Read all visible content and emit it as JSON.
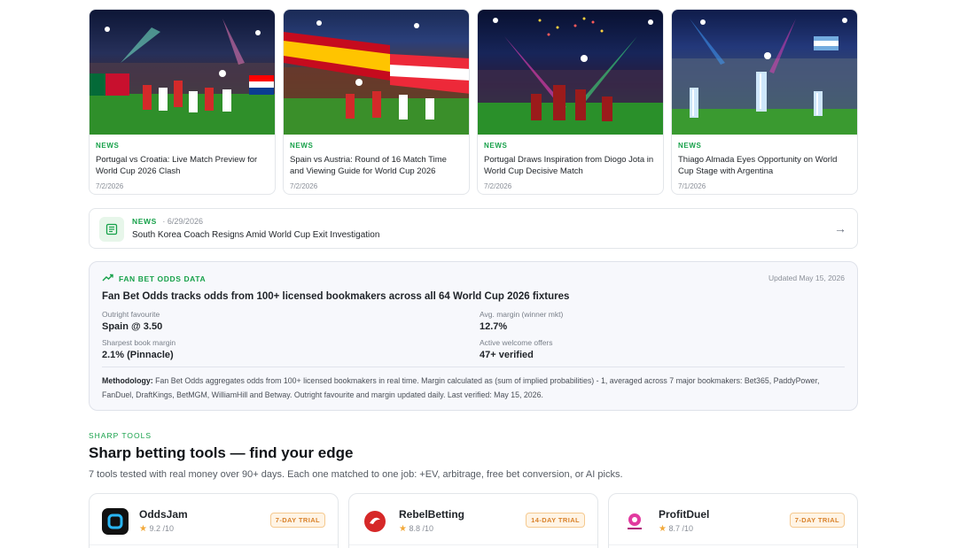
{
  "news_cards": [
    {
      "tag": "NEWS",
      "title": "Portugal vs Croatia: Live Match Preview for World Cup 2026 Clash",
      "date": "7/2/2026"
    },
    {
      "tag": "NEWS",
      "title": "Spain vs Austria: Round of 16 Match Time and Viewing Guide for World Cup 2026",
      "date": "7/2/2026"
    },
    {
      "tag": "NEWS",
      "title": "Portugal Draws Inspiration from Diogo Jota in World Cup Decisive Match",
      "date": "7/2/2026"
    },
    {
      "tag": "NEWS",
      "title": "Thiago Almada Eyes Opportunity on World Cup Stage with Argentina",
      "date": "7/1/2026"
    }
  ],
  "news_row": {
    "tag": "NEWS",
    "date": "· 6/29/2026",
    "headline": "South Korea Coach Resigns Amid World Cup Exit Investigation",
    "icon": "newspaper-icon",
    "arrow_icon": "arrow-right-icon"
  },
  "odds_panel": {
    "label": "FAN BET ODDS DATA",
    "label_icon": "trending-up-icon",
    "updated": "Updated May 15, 2026",
    "heading": "Fan Bet Odds tracks odds from 100+ licensed bookmakers across all 64 World Cup 2026 fixtures",
    "stats": [
      {
        "label": "Outright favourite",
        "value": "Spain @ 3.50"
      },
      {
        "label": "Avg. margin (winner mkt)",
        "value": "12.7%"
      },
      {
        "label": "Sharpest book margin",
        "value": "2.1% (Pinnacle)"
      },
      {
        "label": "Active welcome offers",
        "value": "47+ verified"
      }
    ],
    "methodology_label": "Methodology:",
    "methodology_text": "Fan Bet Odds aggregates odds from 100+ licensed bookmakers in real time. Margin calculated as (sum of implied probabilities) - 1, averaged across 7 major bookmakers: Bet365, PaddyPower, FanDuel, DraftKings, BetMGM, WilliamHill and Betway. Outright favourite and margin updated daily. Last verified: May 15, 2026."
  },
  "sharp_tools": {
    "eyebrow": "SHARP TOOLS",
    "title": "Sharp betting tools — find your edge",
    "subtitle": "7 tools tested with real money over 90+ days. Each one matched to one job: +EV, arbitrage, free bet conversion, or AI picks.",
    "tools": [
      {
        "name": "OddsJam",
        "rating": "9.2",
        "out_of": "/10",
        "trial": "7-DAY TRIAL",
        "logo_color": "#111111"
      },
      {
        "name": "RebelBetting",
        "rating": "8.8",
        "out_of": "/10",
        "trial": "14-DAY TRIAL",
        "logo_color": "#d62828"
      },
      {
        "name": "ProfitDuel",
        "rating": "8.7",
        "out_of": "/10",
        "trial": "7-DAY TRIAL",
        "logo_color": "#b0177a"
      }
    ]
  },
  "colors": {
    "accent": "#17a14a",
    "trial": "#d9822b",
    "star": "#f2a93b"
  }
}
